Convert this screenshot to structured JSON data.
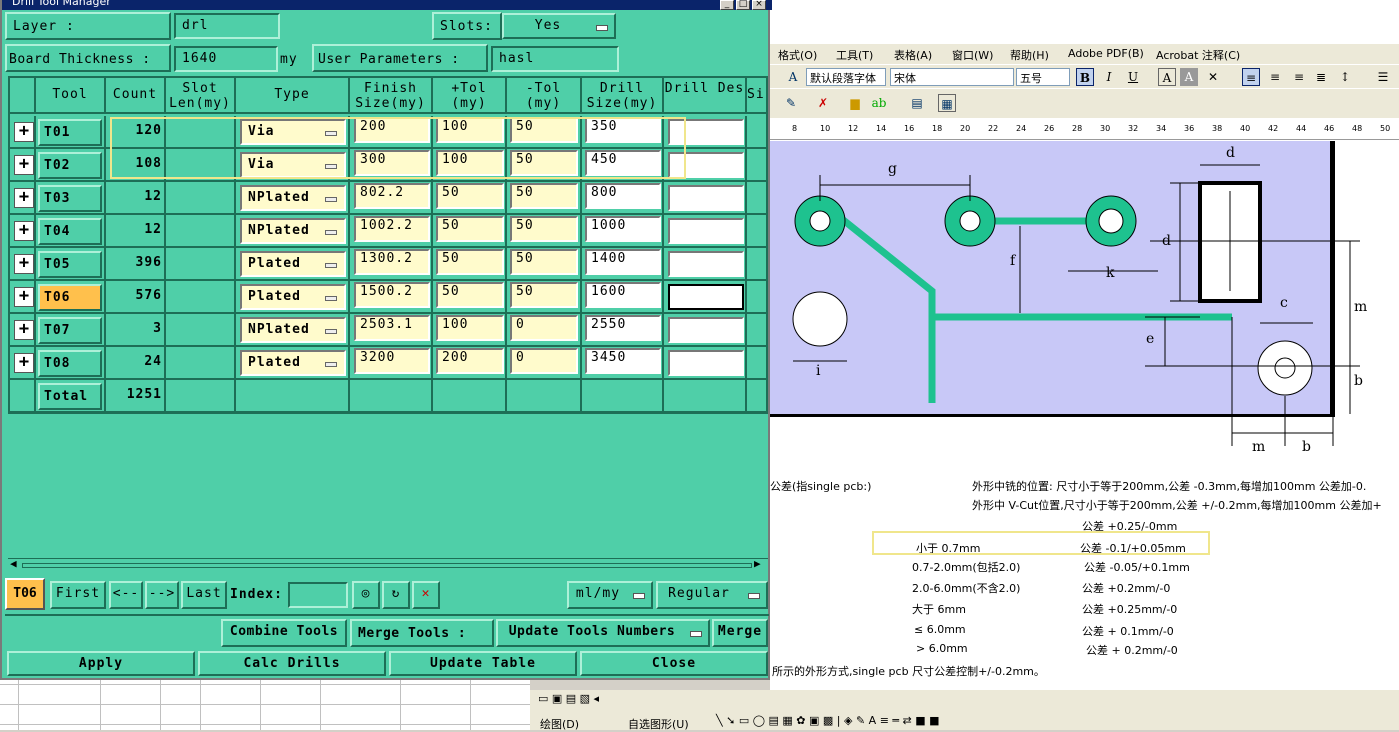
{
  "dialog": {
    "title": "Drill Tool Manager",
    "layer_label": "Layer       :",
    "layer_value": "drl",
    "slots_label": "Slots:",
    "slots_value": "Yes",
    "board_thickness_label": "Board Thickness :",
    "board_thickness_value": "1640",
    "board_thickness_unit": "my",
    "user_params_label": "User Parameters :",
    "user_params_value": "hasl",
    "columns": [
      "Tool",
      "Count",
      "Slot Len(my)",
      "Type",
      "Finish Size(my)",
      "+Tol (my)",
      "-Tol (my)",
      "Drill Size(my)",
      "Drill Des",
      "Si"
    ],
    "rows": [
      {
        "tool": "T01",
        "count": "120",
        "type": "Via",
        "finish": "200",
        "ptol": "100",
        "ntol": "50",
        "drill": "350"
      },
      {
        "tool": "T02",
        "count": "108",
        "type": "Via",
        "finish": "300",
        "ptol": "100",
        "ntol": "50",
        "drill": "450"
      },
      {
        "tool": "T03",
        "count": "12",
        "type": "NPlated",
        "finish": "802.2",
        "ptol": "50",
        "ntol": "50",
        "drill": "800"
      },
      {
        "tool": "T04",
        "count": "12",
        "type": "NPlated",
        "finish": "1002.2",
        "ptol": "50",
        "ntol": "50",
        "drill": "1000"
      },
      {
        "tool": "T05",
        "count": "396",
        "type": "Plated",
        "finish": "1300.2",
        "ptol": "50",
        "ntol": "50",
        "drill": "1400"
      },
      {
        "tool": "T06",
        "count": "576",
        "type": "Plated",
        "finish": "1500.2",
        "ptol": "50",
        "ntol": "50",
        "drill": "1600"
      },
      {
        "tool": "T07",
        "count": "3",
        "type": "NPlated",
        "finish": "2503.1",
        "ptol": "100",
        "ntol": "0",
        "drill": "2550"
      },
      {
        "tool": "T08",
        "count": "24",
        "type": "Plated",
        "finish": "3200",
        "ptol": "200",
        "ntol": "0",
        "drill": "3450"
      }
    ],
    "total_label": "Total",
    "total_count": "1251",
    "nav": {
      "current": "T06",
      "first": "First",
      "prev": "<--",
      "next": "-->",
      "last": "Last",
      "index_label": "Index:",
      "unit": "ml/my",
      "mode": "Regular"
    },
    "buttons": {
      "combine": "Combine Tools",
      "merge_label": "Merge Tools :",
      "merge_select": "Update Tools Numbers",
      "merge": "Merge",
      "apply": "Apply",
      "calc": "Calc Drills",
      "update": "Update Table",
      "close": "Close"
    },
    "colors": {
      "dialog_bg": "#4fcfa8",
      "input_bg": "#fffbcc",
      "selected_tool": "#ffc04c",
      "highlight": "#f0e68c"
    }
  },
  "word": {
    "menu": [
      "格式(O)",
      "工具(T)",
      "表格(A)",
      "窗口(W)",
      "帮助(H)",
      "Adobe PDF(B)",
      "Acrobat 注释(C)"
    ],
    "style_combo": "默认段落字体",
    "font_combo": "宋体",
    "size_combo": "五号",
    "ruler": [
      "8",
      "10",
      "12",
      "14",
      "16",
      "18",
      "20",
      "22",
      "24",
      "26",
      "28",
      "30",
      "32",
      "34",
      "36",
      "38",
      "40",
      "42",
      "44",
      "46",
      "48",
      "50"
    ],
    "fig_labels": {
      "g": "g",
      "d": "d",
      "f": "f",
      "k": "k",
      "m": "m",
      "c": "c",
      "e": "e",
      "i": "i",
      "b": "b"
    },
    "lines": [
      "公差(指single pcb:)",
      "外形中铣的位置:  尺寸小于等于200mm,公差 -0.3mm,每增加100mm 公差加-0.",
      "外形中 V-Cut位置,尺寸小于等于200mm,公差 +/-0.2mm,每增加100mm 公差加+",
      "公差 +0.25/-0mm",
      "小于 0.7mm",
      "公差 -0.1/+0.05mm",
      "0.7-2.0mm(包括2.0)",
      "公差  -0.05/+0.1mm",
      "2.0-6.0mm(不含2.0)",
      "公差 +0.2mm/-0",
      "大于 6mm",
      "公差 +0.25mm/-0",
      "≤ 6.0mm",
      "公差 + 0.1mm/-0",
      "> 6.0mm",
      "公差 + 0.2mm/-0",
      "所示的外形方式,single pcb 尺寸公差控制+/-0.2mm。"
    ],
    "draw_label": "绘图(D)",
    "autoshape_label": "自选图形(U)"
  }
}
